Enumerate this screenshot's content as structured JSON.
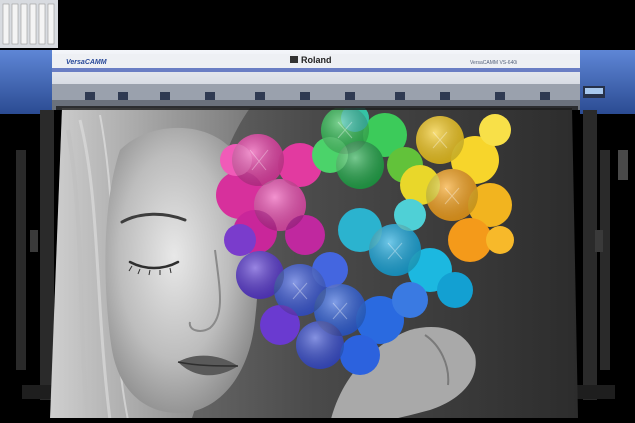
{
  "printer": {
    "brand": "Roland",
    "series_logo": "VersaCAMM",
    "model_label": "VersaCAMM VS-640i",
    "colors": {
      "body": "#e6e9ef",
      "accent_blue": "#3c63b4",
      "dark_frame": "#1a1a1a"
    }
  },
  "print": {
    "subject": "woman-with-rainbow-hydrangea",
    "flower_colors": [
      "#e23aa0",
      "#c026b0",
      "#33c04a",
      "#f4d21f",
      "#f6a21c",
      "#1aa3d9",
      "#2f5fd8",
      "#6a3ad0"
    ]
  }
}
